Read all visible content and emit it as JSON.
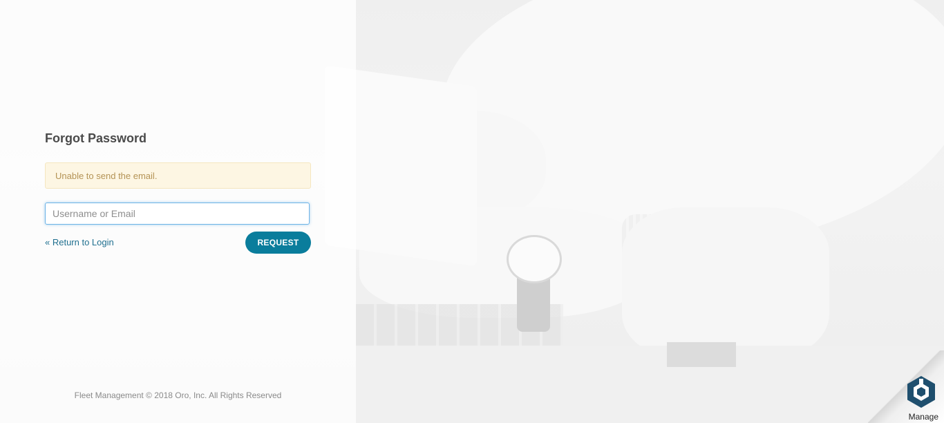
{
  "form": {
    "title": "Forgot Password",
    "alert": "Unable to send the email.",
    "username_placeholder": "Username or Email",
    "back_link": "« Return to Login",
    "request_label": "REQUEST"
  },
  "footer": {
    "text": "Fleet Management © 2018 Oro, Inc. All Rights Reserved"
  },
  "badge": {
    "label": "Manage",
    "icon": "oro-hexagon-logo-icon",
    "color": "#1f4f6e"
  },
  "colors": {
    "accent": "#0a7d9c",
    "link": "#1f6f8f",
    "alert_text": "#b49355",
    "alert_bg": "#fdf6e3"
  }
}
